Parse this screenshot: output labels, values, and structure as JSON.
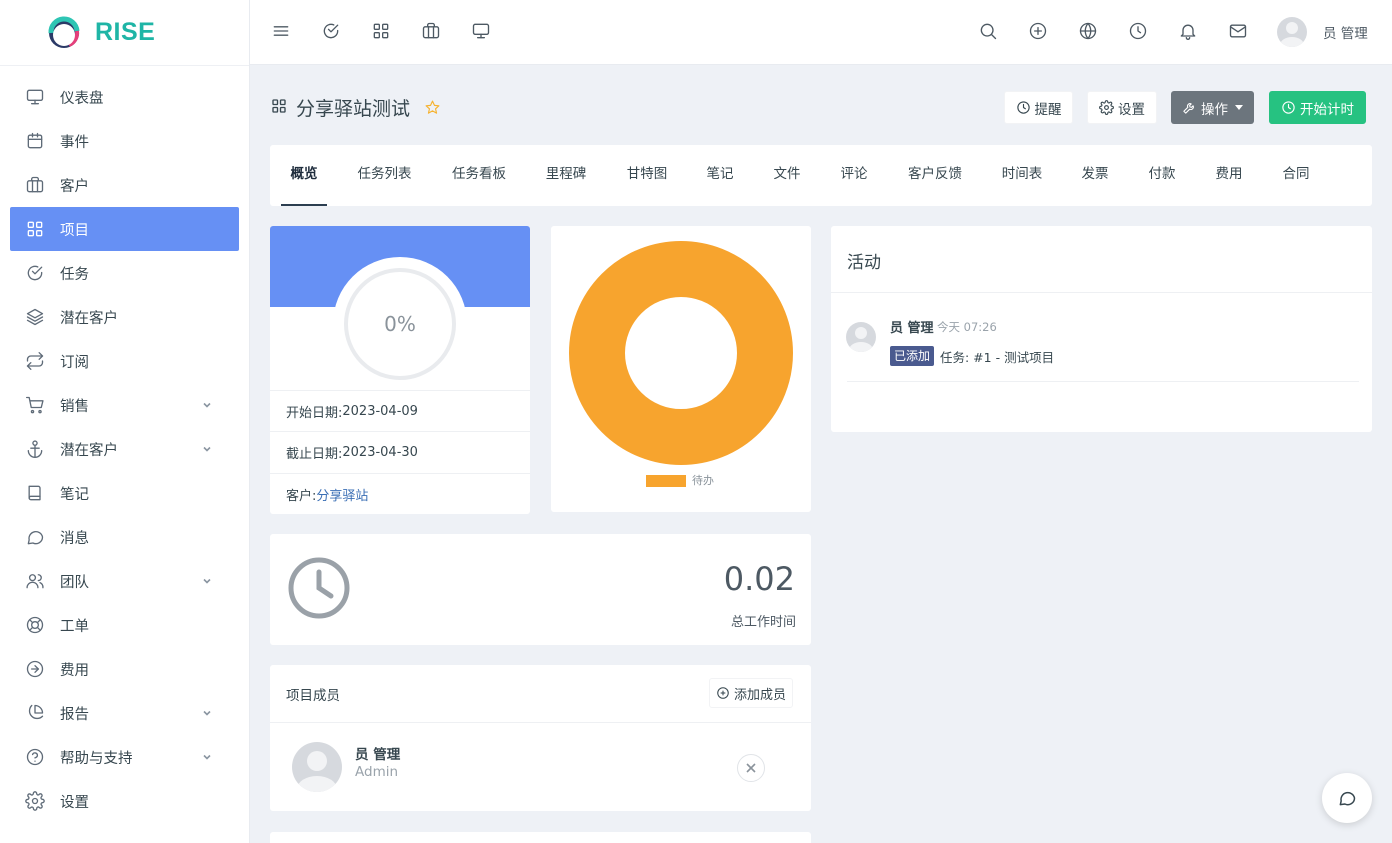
{
  "brand": {
    "name": "RISE"
  },
  "sidebar": {
    "items": [
      {
        "label": "仪表盘",
        "icon": "monitor-icon",
        "active": false,
        "expandable": false
      },
      {
        "label": "事件",
        "icon": "calendar-icon",
        "active": false,
        "expandable": false
      },
      {
        "label": "客户",
        "icon": "briefcase-icon",
        "active": false,
        "expandable": false
      },
      {
        "label": "项目",
        "icon": "grid-icon",
        "active": true,
        "expandable": false
      },
      {
        "label": "任务",
        "icon": "check-circle-icon",
        "active": false,
        "expandable": false
      },
      {
        "label": "潜在客户",
        "icon": "layers-icon",
        "active": false,
        "expandable": false
      },
      {
        "label": "订阅",
        "icon": "repeat-icon",
        "active": false,
        "expandable": false
      },
      {
        "label": "销售",
        "icon": "cart-icon",
        "active": false,
        "expandable": true
      },
      {
        "label": "潜在客户",
        "icon": "anchor-icon",
        "active": false,
        "expandable": true
      },
      {
        "label": "笔记",
        "icon": "book-icon",
        "active": false,
        "expandable": false
      },
      {
        "label": "消息",
        "icon": "message-icon",
        "active": false,
        "expandable": false
      },
      {
        "label": "团队",
        "icon": "users-icon",
        "active": false,
        "expandable": true
      },
      {
        "label": "工单",
        "icon": "lifebuoy-icon",
        "active": false,
        "expandable": false
      },
      {
        "label": "费用",
        "icon": "arrow-circle-icon",
        "active": false,
        "expandable": false
      },
      {
        "label": "报告",
        "icon": "pie-chart-icon",
        "active": false,
        "expandable": true
      },
      {
        "label": "帮助与支持",
        "icon": "help-circle-icon",
        "active": false,
        "expandable": true
      },
      {
        "label": "设置",
        "icon": "gear-icon",
        "active": false,
        "expandable": false
      }
    ]
  },
  "topbar": {
    "left_icons": [
      "menu-icon",
      "check-circle-icon",
      "grid-icon",
      "briefcase-icon",
      "monitor-icon"
    ],
    "right_icons": [
      "search-icon",
      "plus-circle-icon",
      "globe-icon",
      "clock-icon",
      "bell-icon",
      "mail-icon"
    ],
    "user_name": "员 管理"
  },
  "header": {
    "title": "分享驿站测试",
    "buttons": {
      "reminder": "提醒",
      "settings": "设置",
      "actions": "操作",
      "start_timer": "开始计时"
    }
  },
  "tabs": [
    "概览",
    "任务列表",
    "任务看板",
    "里程碑",
    "甘特图",
    "笔记",
    "文件",
    "评论",
    "客户反馈",
    "时间表",
    "发票",
    "付款",
    "费用",
    "合同"
  ],
  "active_tab": 0,
  "progress": {
    "percent_label": "0%",
    "start_date_label": "开始日期: ",
    "start_date": "2023-04-09",
    "deadline_label": "截止日期: ",
    "deadline": "2023-04-30",
    "client_label": "客户: ",
    "client": "分享驿站"
  },
  "chart_data": {
    "type": "pie",
    "donut": true,
    "categories": [
      "待办"
    ],
    "values": [
      1
    ],
    "colors": [
      "#f7a42e"
    ],
    "legend": "bottom"
  },
  "activity": {
    "title": "活动",
    "items": [
      {
        "user": "员 管理",
        "time": "今天 07:26",
        "badge": "已添加",
        "text": "任务: #1 - 测试项目"
      }
    ]
  },
  "time_tracking": {
    "value": "0.02",
    "label": "总工作时间"
  },
  "members": {
    "title": "项目成员",
    "add_label": "添加成员",
    "list": [
      {
        "name": "员 管理",
        "role": "Admin"
      }
    ]
  },
  "colors": {
    "primary": "#6690f4",
    "success": "#26c281",
    "brand": "#1fb5a6",
    "pending": "#f7a42e"
  }
}
